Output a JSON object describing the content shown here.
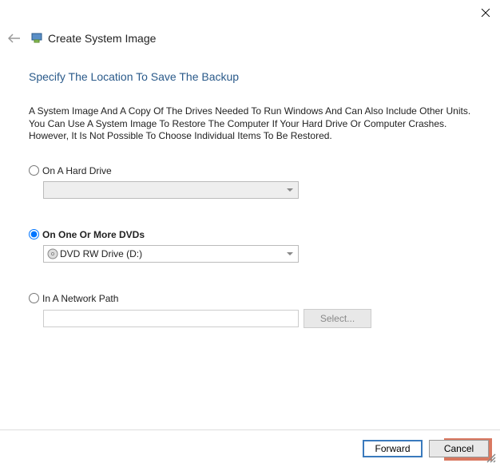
{
  "window": {
    "title": "Create System Image"
  },
  "section": {
    "title": "Specify The Location To Save The Backup"
  },
  "description": "A System Image And A Copy Of The Drives Needed To Run Windows And Can Also Include Other Units. You Can Use A System Image To Restore The Computer If Your Hard Drive Or Computer Crashes. However, It Is Not Possible To Choose Individual Items To Be Restored.",
  "options": {
    "hard_drive": {
      "label": "On A Hard Drive",
      "selected": false
    },
    "dvds": {
      "label": "On One Or More DVDs",
      "selected": true,
      "value": "DVD RW Drive (D:)"
    },
    "network": {
      "label": "In A Network Path",
      "selected": false,
      "value": "",
      "select_button": "Select..."
    }
  },
  "footer": {
    "forward": "Forward",
    "cancel": "Cancel"
  }
}
